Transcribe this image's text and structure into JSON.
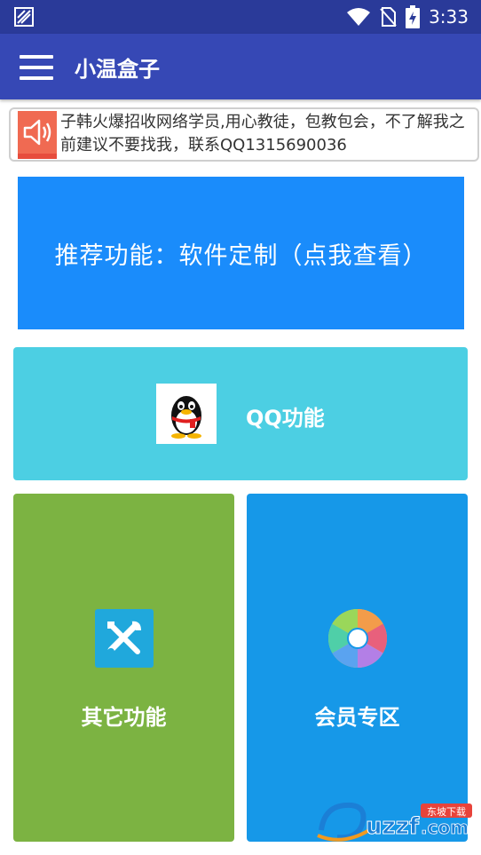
{
  "status_bar": {
    "time": "3:33"
  },
  "app_bar": {
    "title": "小温盒子"
  },
  "notice": {
    "text": "子韩火爆招收网络学员,用心教徒，包教包会，不了解我之前建议不要找我，联系QQ1315690036"
  },
  "recommend": {
    "label": "推荐功能：软件定制（点我查看）"
  },
  "qq_card": {
    "label": "QQ功能"
  },
  "tiles": [
    {
      "label": "其它功能"
    },
    {
      "label": "会员专区"
    }
  ],
  "watermark": {
    "brand": "uzzf",
    "suffix": ".com",
    "badge": "东坡下载"
  },
  "colors": {
    "status_bar": "#2a3a99",
    "app_bar": "#3648b5",
    "recommend": "#1a8cfb",
    "qq_card": "#4ccfe3",
    "tile_other": "#7cb342",
    "tile_vip": "#1698e8"
  },
  "icons": [
    "app-notification-icon",
    "wifi-icon",
    "no-sim-icon",
    "battery-icon",
    "menu-icon",
    "speaker-icon",
    "qq-penguin-icon",
    "tools-icon",
    "aperture-icon"
  ]
}
